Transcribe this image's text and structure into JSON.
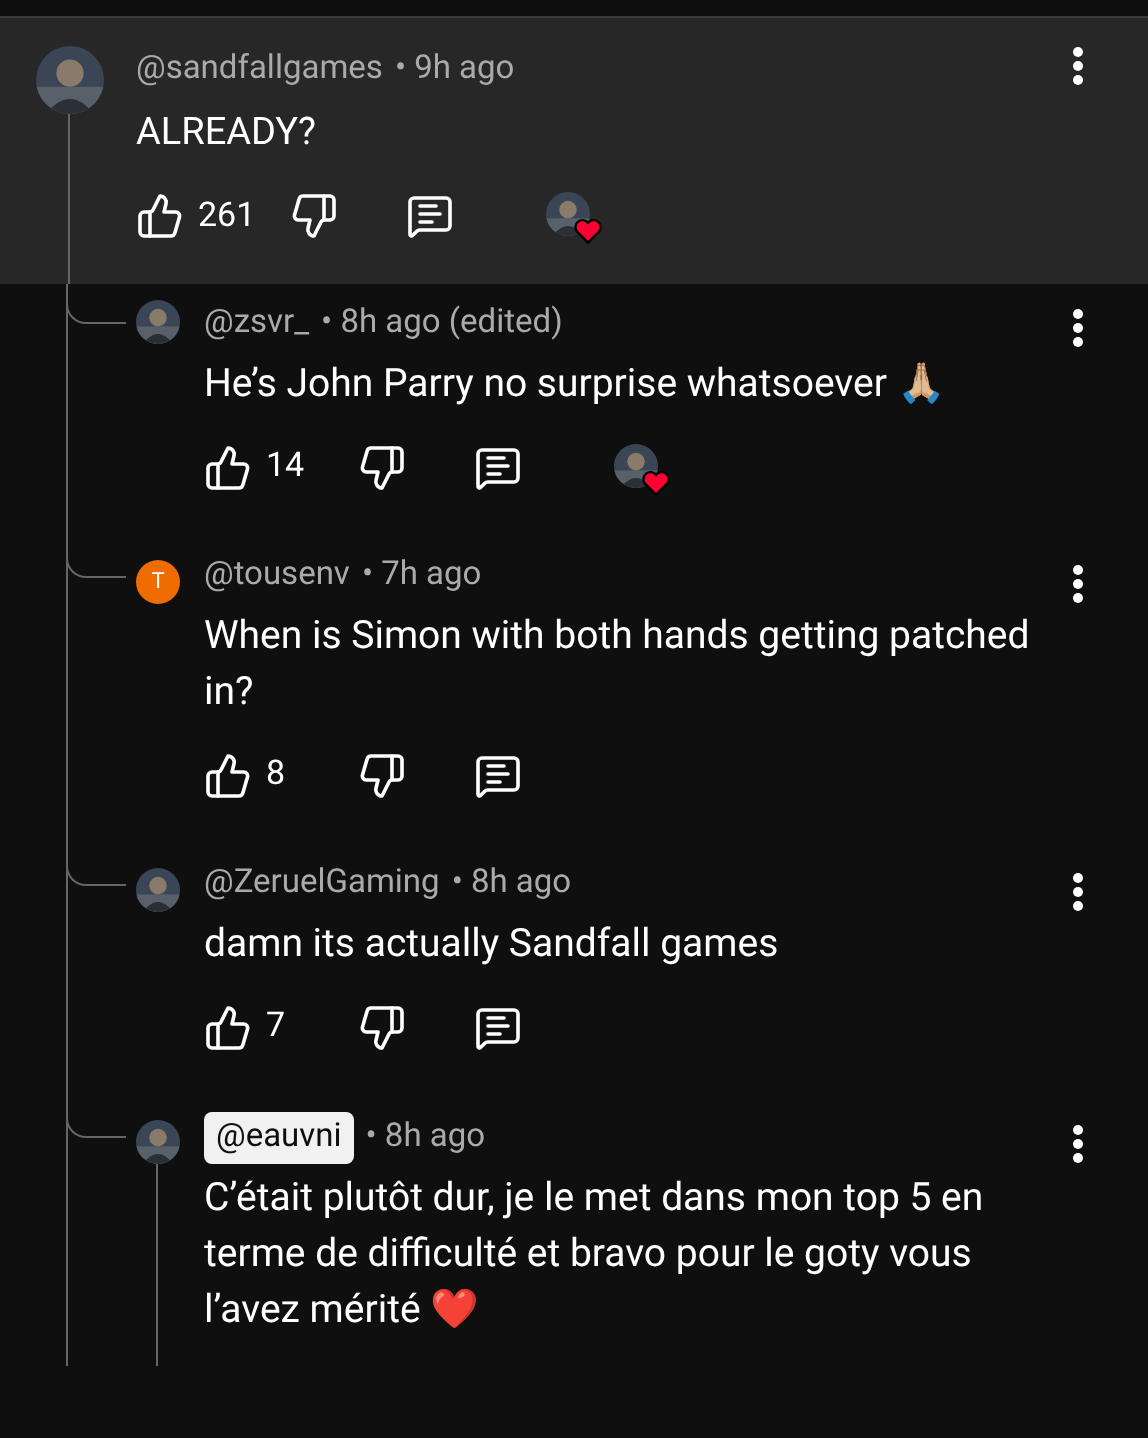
{
  "comment": {
    "author": "@sandfallgames",
    "time": "• 9h ago",
    "text": "ALREADY?",
    "likes": "261",
    "hearted": true
  },
  "replies": [
    {
      "author": "@zsvr_",
      "author_highlighted": false,
      "time": "• 8h ago (edited)",
      "text": "He’s John Parry no surprise whatsoever 🙏🏼",
      "likes": "14",
      "hearted": true,
      "actions": true
    },
    {
      "avatar": {
        "kind": "letter",
        "letter": "T",
        "color": "#ef6c00"
      },
      "author": "@tousenv",
      "author_highlighted": false,
      "time": "• 7h ago",
      "text": "When is Simon with both hands getting patched in?",
      "likes": "8",
      "hearted": false,
      "actions": true
    },
    {
      "author": "@ZeruelGaming",
      "author_highlighted": false,
      "time": "• 8h ago",
      "text": "damn its actually Sandfall games",
      "likes": "7",
      "hearted": false,
      "actions": true
    },
    {
      "author": "@eauvni",
      "author_highlighted": true,
      "time": "• 8h ago",
      "text": "C’était plutôt dur, je le met dans mon top 5 en terme de difficulté et bravo pour le goty vous l’avez mérité ❤️",
      "hearted": false,
      "actions": false
    }
  ]
}
